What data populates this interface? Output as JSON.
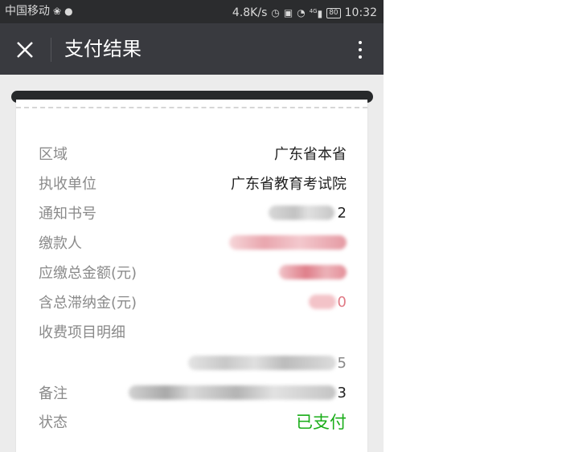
{
  "statusbar": {
    "carrier": "中国移动",
    "speed": "4.8K/s",
    "network": "4G",
    "battery": "80",
    "time": "10:32"
  },
  "navbar": {
    "title": "支付结果",
    "close_icon": "close-icon",
    "more_icon": "more-vertical-icon"
  },
  "details": {
    "region_label": "区域",
    "region_value": "广东省本省",
    "unit_label": "执收单位",
    "unit_value": "广东省教育考试院",
    "notice_label": "通知书号",
    "notice_value": "2",
    "payer_label": "缴款人",
    "amount_label": "应缴总金额(元)",
    "late_fee_label": "含总滞纳金(元)",
    "late_fee_value": "0",
    "items_label": "收费项目明细",
    "items_value": "5",
    "remark_label": "备注",
    "remark_value": "3",
    "status_label": "状态",
    "status_value": "已支付"
  },
  "colors": {
    "statusbar_bg": "#2b2c2e",
    "navbar_bg": "#393a3f",
    "page_bg": "#ececec",
    "paid_green": "#1aad19",
    "redacted_red": "#e58a94",
    "redacted_gray": "#b0b0b0"
  }
}
